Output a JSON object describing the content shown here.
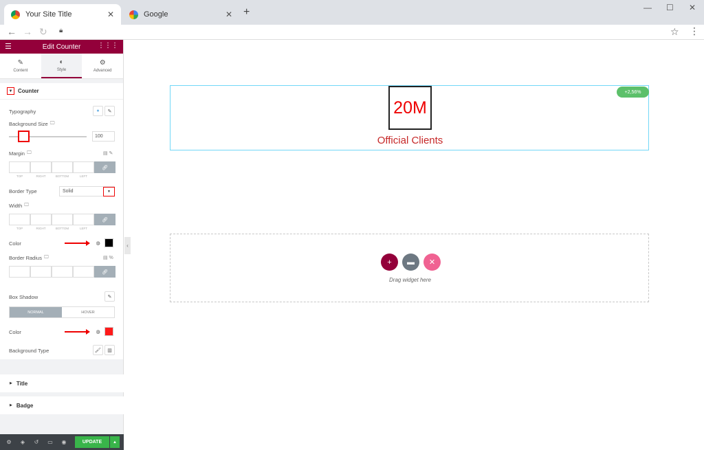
{
  "browser": {
    "tabs": [
      {
        "title": "Your Site Title",
        "active": true
      },
      {
        "title": "Google",
        "active": false
      }
    ]
  },
  "panel": {
    "header_title": "Edit Counter",
    "tabs": [
      {
        "label": "Content",
        "icon": "pencil-icon"
      },
      {
        "label": "Style",
        "icon": "half-circle-icon",
        "active": true
      },
      {
        "label": "Advanced",
        "icon": "gear-icon"
      }
    ],
    "section_title": "Counter",
    "typography_label": "Typography",
    "background_size_label": "Background Size",
    "background_size_value": "100",
    "margin_label": "Margin",
    "dim_labels": [
      "TOP",
      "RIGHT",
      "BOTTOM",
      "LEFT"
    ],
    "border_type_label": "Border Type",
    "border_type_value": "Solid",
    "width_label": "Width",
    "color_label": "Color",
    "color_value": "#000000",
    "border_radius_label": "Border Radius",
    "box_shadow_label": "Box Shadow",
    "normal_label": "NORMAL",
    "hover_label": "HOVER",
    "color2_label": "Color",
    "color2_value": "#ff1a1a",
    "background_type_label": "Background Type",
    "title_section": "Title",
    "badge_section": "Badge",
    "update_label": "UPDATE"
  },
  "canvas": {
    "counter_number": "20M",
    "counter_title": "Official Clients",
    "badge_text": "+2,56%",
    "drag_text": "Drag widget here"
  },
  "colors": {
    "brand": "#93003a",
    "update": "#39b54a",
    "badge": "#5cc06a"
  }
}
